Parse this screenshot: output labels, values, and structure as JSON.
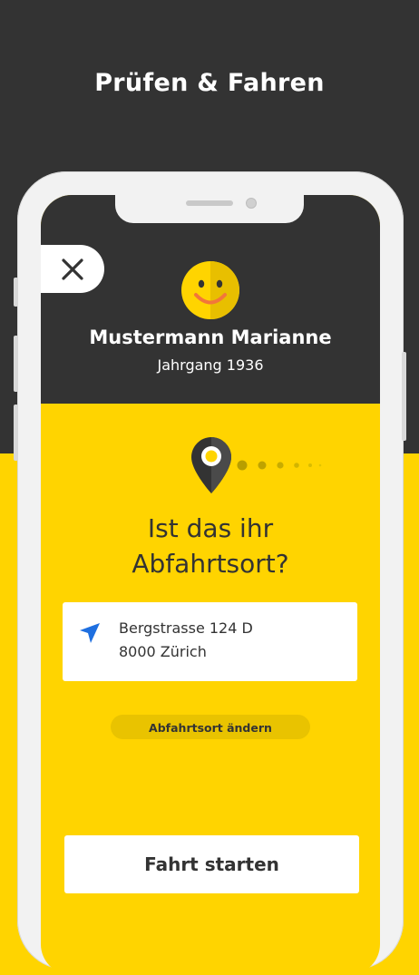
{
  "promo": {
    "title": "Prüfen & Fahren"
  },
  "profile": {
    "name": "Mustermann Marianne",
    "year": "Jahrgang 1936",
    "avatar_icon": "smiley-face-icon"
  },
  "question": {
    "line1": "Ist das ihr",
    "line2": "Abfahrtsort?"
  },
  "address": {
    "street": "Bergstrasse 124 D",
    "city": "8000 Zürich",
    "icon": "navigation-arrow-icon"
  },
  "actions": {
    "change_label": "Abfahrtsort ändern",
    "start_label": "Fahrt starten",
    "close_icon": "close-icon"
  },
  "colors": {
    "yellow": "#FFD400",
    "dark": "#333333",
    "accent_blue": "#1E6FE0",
    "smile_orange": "#F2763A"
  }
}
